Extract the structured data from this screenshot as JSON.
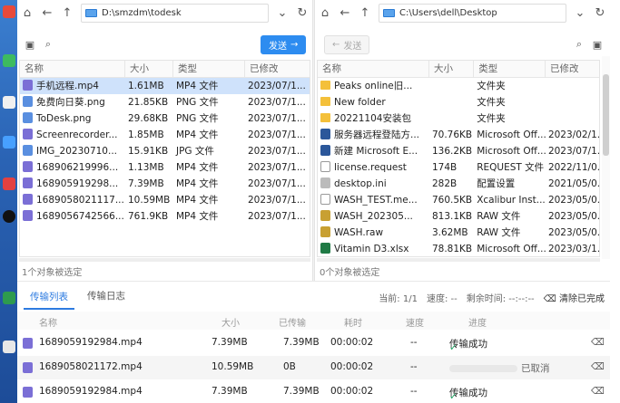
{
  "desktop": {
    "labels": [
      "",
      "",
      "",
      "",
      "",
      "",
      "",
      ""
    ]
  },
  "left_pane": {
    "path": "D:\\smzdm\\todesk",
    "send_label": "发送",
    "columns": [
      "名称",
      "大小",
      "类型",
      "已修改"
    ],
    "files": [
      {
        "name": "手机远程.mp4",
        "size": "1.61MB",
        "type": "MP4 文件",
        "modified": "2023/07/1...",
        "icon": "video-icon",
        "selected": true
      },
      {
        "name": "免费向日葵.png",
        "size": "21.85KB",
        "type": "PNG 文件",
        "modified": "2023/07/1...",
        "icon": "image-icon"
      },
      {
        "name": "ToDesk.png",
        "size": "29.68KB",
        "type": "PNG 文件",
        "modified": "2023/07/1...",
        "icon": "image-icon"
      },
      {
        "name": "Screenrecorder...",
        "size": "1.85MB",
        "type": "MP4 文件",
        "modified": "2023/07/1...",
        "icon": "video-icon"
      },
      {
        "name": "IMG_20230710...",
        "size": "15.91KB",
        "type": "JPG 文件",
        "modified": "2023/07/1...",
        "icon": "image-icon"
      },
      {
        "name": "168906219996...",
        "size": "1.13MB",
        "type": "MP4 文件",
        "modified": "2023/07/1...",
        "icon": "video-icon"
      },
      {
        "name": "168905919298...",
        "size": "7.39MB",
        "type": "MP4 文件",
        "modified": "2023/07/1...",
        "icon": "video-icon"
      },
      {
        "name": "1689058021117...",
        "size": "10.59MB",
        "type": "MP4 文件",
        "modified": "2023/07/1...",
        "icon": "video-icon"
      },
      {
        "name": "1689056742566...",
        "size": "761.9KB",
        "type": "MP4 文件",
        "modified": "2023/07/1...",
        "icon": "video-icon"
      }
    ],
    "status": "1个对象被选定"
  },
  "right_pane": {
    "path": "C:\\Users\\dell\\Desktop",
    "send_label": "发送",
    "columns": [
      "名称",
      "大小",
      "类型",
      "已修改"
    ],
    "files": [
      {
        "name": "Peaks online旧...",
        "size": "",
        "type": "文件夹",
        "modified": "",
        "icon": "folder-icon"
      },
      {
        "name": "New folder",
        "size": "",
        "type": "文件夹",
        "modified": "",
        "icon": "folder-icon"
      },
      {
        "name": "20221104安装包",
        "size": "",
        "type": "文件夹",
        "modified": "",
        "icon": "folder-icon"
      },
      {
        "name": "服务器远程登陆方...",
        "size": "70.76KB",
        "type": "Microsoft Off...",
        "modified": "2023/02/1...",
        "icon": "word-icon"
      },
      {
        "name": "新建 Microsoft E...",
        "size": "136.2KB",
        "type": "Microsoft Off...",
        "modified": "2023/07/1...",
        "icon": "word-icon"
      },
      {
        "name": "license.request",
        "size": "174B",
        "type": "REQUEST 文件",
        "modified": "2022/11/0...",
        "icon": "document-icon"
      },
      {
        "name": "desktop.ini",
        "size": "282B",
        "type": "配置设置",
        "modified": "2021/05/0...",
        "icon": "settings-file-icon"
      },
      {
        "name": "WASH_TEST.me...",
        "size": "760.5KB",
        "type": "Xcalibur Inst...",
        "modified": "2023/05/0...",
        "icon": "document-icon"
      },
      {
        "name": "WASH_202305...",
        "size": "813.1KB",
        "type": "RAW 文件",
        "modified": "2023/05/0...",
        "icon": "raw-file-icon"
      },
      {
        "name": "WASH.raw",
        "size": "3.62MB",
        "type": "RAW 文件",
        "modified": "2023/05/0...",
        "icon": "raw-file-icon"
      },
      {
        "name": "Vitamin D3.xlsx",
        "size": "78.81KB",
        "type": "Microsoft Off...",
        "modified": "2023/03/1...",
        "icon": "excel-icon"
      }
    ],
    "status": "0个对象被选定"
  },
  "transfer": {
    "tabs": [
      "传输列表",
      "传输日志"
    ],
    "page_label": "当前: 1/1",
    "speed_label": "速度: --",
    "remaining_label": "剩余时间: --:--:--",
    "clear_label": "清除已完成",
    "columns": [
      "名称",
      "大小",
      "已传输",
      "耗时",
      "速度",
      "进度"
    ],
    "rows": [
      {
        "name": "1689059192984.mp4",
        "size": "7.39MB",
        "transferred": "7.39MB",
        "elapsed": "00:00:02",
        "speed": "--",
        "progress": "传输成功",
        "state": "success"
      },
      {
        "name": "1689058021172.mp4",
        "size": "10.59MB",
        "transferred": "0B",
        "elapsed": "00:00:02",
        "speed": "--",
        "progress": "已取消",
        "state": "cancelled"
      },
      {
        "name": "1689059192984.mp4",
        "size": "7.39MB",
        "transferred": "7.39MB",
        "elapsed": "00:00:02",
        "speed": "--",
        "progress": "传输成功",
        "state": "success"
      }
    ]
  }
}
